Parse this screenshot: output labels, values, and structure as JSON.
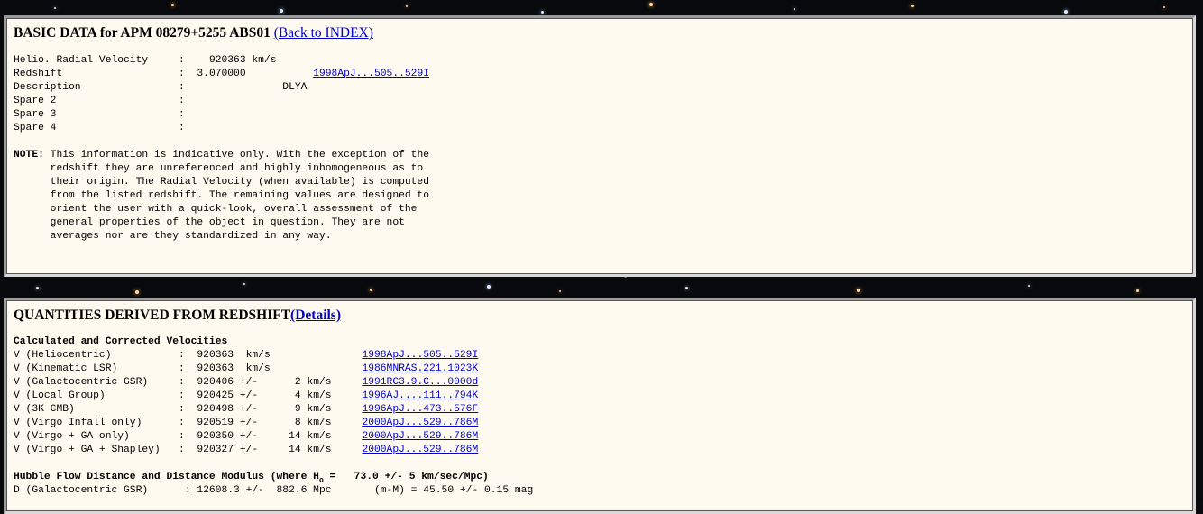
{
  "basic": {
    "title": "BASIC DATA for APM 08279+5255 ABS01 ",
    "back_link": "(Back to INDEX)",
    "rows": [
      {
        "label": "Helio. Radial Velocity     :",
        "value": "    920363 km/s",
        "ref": ""
      },
      {
        "label": "Redshift                   :",
        "value": "  3.070000           ",
        "ref": "1998ApJ...505..529I"
      },
      {
        "label": "Description                :",
        "value": "                DLYA",
        "ref": ""
      },
      {
        "label": "Spare 2                    :",
        "value": "",
        "ref": ""
      },
      {
        "label": "Spare 3                    :",
        "value": "",
        "ref": ""
      },
      {
        "label": "Spare 4                    :",
        "value": "",
        "ref": ""
      }
    ],
    "note_label": "NOTE:",
    "note_text": " This information is indicative only. With the exception of the\n      redshift they are unreferenced and highly inhomogeneous as to\n      their origin. The Radial Velocity (when available) is computed\n      from the listed redshift. The remaining values are designed to\n      orient the user with a quick-look, overall assessment of the\n      general properties of the object in question. They are not\n      averages nor are they standardized in any way."
  },
  "derived": {
    "title": "QUANTITIES DERIVED FROM REDSHIFT",
    "details_link": "(Details)",
    "velocities_heading": "Calculated and Corrected Velocities",
    "velocities": [
      {
        "label": "V (Heliocentric)           :",
        "value": "  920363  km/s               ",
        "ref": "1998ApJ...505..529I"
      },
      {
        "label": "V (Kinematic LSR)          :",
        "value": "  920363  km/s               ",
        "ref": "1986MNRAS.221.1023K"
      },
      {
        "label": "V (Galactocentric GSR)     :",
        "value": "  920406 +/-      2 km/s     ",
        "ref": "1991RC3.9.C...0000d"
      },
      {
        "label": "V (Local Group)            :",
        "value": "  920425 +/-      4 km/s     ",
        "ref": "1996AJ....111..794K"
      },
      {
        "label": "V (3K CMB)                 :",
        "value": "  920498 +/-      9 km/s     ",
        "ref": "1996ApJ...473..576F"
      },
      {
        "label": "V (Virgo Infall only)      :",
        "value": "  920519 +/-      8 km/s     ",
        "ref": "2000ApJ...529..786M"
      },
      {
        "label": "V (Virgo + GA only)        :",
        "value": "  920350 +/-     14 km/s     ",
        "ref": "2000ApJ...529..786M"
      },
      {
        "label": "V (Virgo + GA + Shapley)   :",
        "value": "  920327 +/-     14 km/s     ",
        "ref": "2000ApJ...529..786M"
      }
    ],
    "hubble_heading_a": "Hubble Flow Distance and Distance Modulus (where H",
    "hubble_heading_sub": "o",
    "hubble_heading_b": " =   73.0 +/- 5 km/sec/Mpc)",
    "distance_row": "D (Galactocentric GSR)      : 12608.3 +/-  882.6 Mpc       (m-M) = 45.50 +/- 0.15 mag"
  }
}
